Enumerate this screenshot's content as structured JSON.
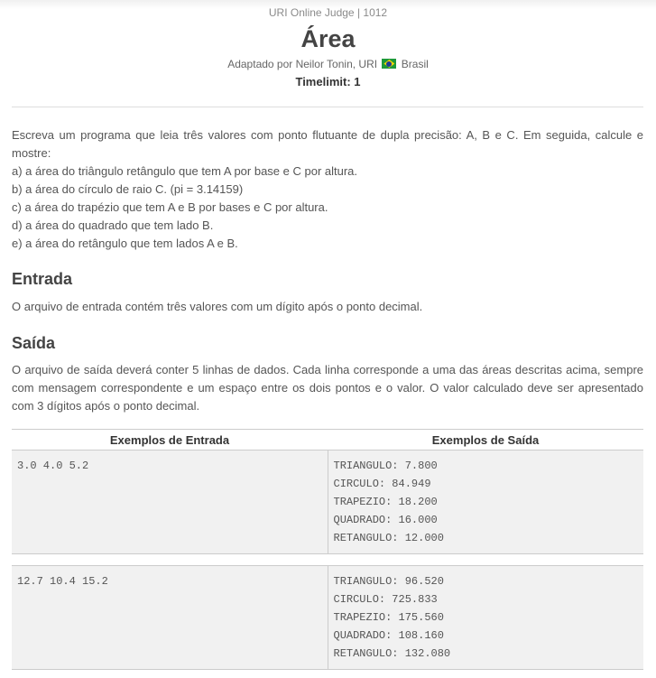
{
  "header": {
    "judge": "URI Online Judge | 1012",
    "title": "Área",
    "adapted_prefix": "Adaptado por Neilor Tonin, URI",
    "country": "Brasil",
    "flag_icon": "brazil-flag-icon",
    "timelimit": "Timelimit: 1"
  },
  "description": {
    "intro": "Escreva um programa que leia três valores com ponto flutuante de dupla precisão: A, B e C. Em seguida, calcule e mostre:",
    "items": [
      "a) a área do triângulo retângulo que tem A por base e C por altura.",
      "b) a área do círculo de raio C. (pi = 3.14159)",
      "c) a área do trapézio que tem A e B por bases e C por altura.",
      "d) a área do quadrado que tem lado B.",
      "e) a área do retângulo que tem lados A e B."
    ]
  },
  "input_section": {
    "title": "Entrada",
    "text": "O arquivo de entrada contém três valores com um dígito após o ponto decimal."
  },
  "output_section": {
    "title": "Saída",
    "text": "O arquivo de saída deverá conter 5 linhas de dados. Cada linha corresponde a uma das áreas descritas acima, sempre com mensagem correspondente e um espaço entre os dois pontos e o valor. O valor calculado deve ser apresentado com 3 dígitos após o ponto decimal."
  },
  "samples": {
    "header_input": "Exemplos de Entrada",
    "header_output": "Exemplos de Saída",
    "examples": [
      {
        "input": "3.0 4.0 5.2",
        "output": [
          "TRIANGULO: 7.800",
          "CIRCULO: 84.949",
          "TRAPEZIO: 18.200",
          "QUADRADO: 16.000",
          "RETANGULO: 12.000"
        ]
      },
      {
        "input": "12.7 10.4 15.2",
        "output": [
          "TRIANGULO: 96.520",
          "CIRCULO: 725.833",
          "TRAPEZIO: 175.560",
          "QUADRADO: 108.160",
          "RETANGULO: 132.080"
        ]
      }
    ]
  }
}
